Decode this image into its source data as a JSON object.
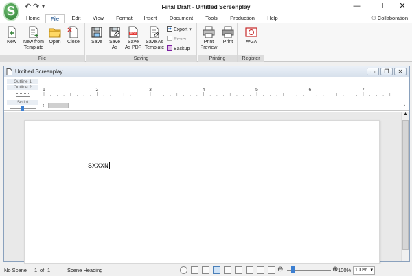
{
  "app": {
    "window_title": "Final Draft - Untitled Screenplay",
    "logo_letter": "S"
  },
  "window_controls": {
    "minimize": "—",
    "maximize": "☐",
    "close": "✕"
  },
  "menu": {
    "tabs": [
      "Home",
      "File",
      "Edit",
      "View",
      "Format",
      "Insert",
      "Document",
      "Tools",
      "Production",
      "Help"
    ],
    "active": "File",
    "collaboration": "Collaboration"
  },
  "ribbon": {
    "groups": {
      "file": {
        "label": "File",
        "new": "New",
        "new_from_template": [
          "New from",
          "Template"
        ],
        "open": "Open",
        "close": "Close"
      },
      "saving": {
        "label": "Saving",
        "save": "Save",
        "save_as": [
          "Save",
          "As"
        ],
        "save_as_pdf": [
          "Save",
          "As PDF"
        ],
        "save_as_template": [
          "Save As",
          "Template"
        ],
        "export": "Export",
        "revert": "Revert",
        "backup": "Backup"
      },
      "printing": {
        "label": "Printing",
        "print_preview": [
          "Print",
          "Preview"
        ],
        "print": "Print"
      },
      "register": {
        "label": "Register",
        "wga": "WGA"
      }
    }
  },
  "document": {
    "title": "Untitled Screenplay",
    "outline_labels": [
      "Outline 1",
      "Outline 2"
    ],
    "script_label": "Script",
    "ruler_numbers": [
      "1",
      "2",
      "3",
      "4",
      "5",
      "6",
      "7"
    ],
    "content_text": "SXXXN"
  },
  "statusbar": {
    "scene": "No Scene",
    "page": "1",
    "of_label": "of",
    "total_pages": "1",
    "element": "Scene Heading",
    "zoom_readout": "100%",
    "zoom_select": "100%"
  }
}
